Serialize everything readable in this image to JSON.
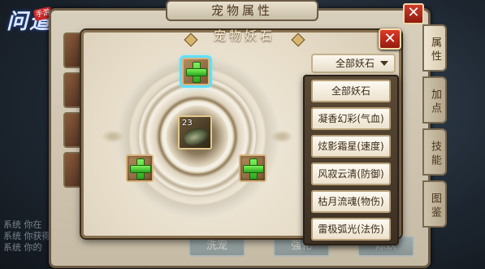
{
  "game": {
    "logo_text": "问道",
    "logo_badge": "手游"
  },
  "chat": {
    "lines": [
      "系统 你在",
      "系统 你获得",
      "系统 你的"
    ]
  },
  "outer_window": {
    "title": "宠物属性",
    "close_label": "✕",
    "side_tabs": [
      "属性",
      "加点",
      "技能",
      "图鉴"
    ],
    "bottom_buttons": [
      "洗宠",
      "强化",
      "炼妖"
    ]
  },
  "dialog": {
    "title": "宠物妖石",
    "close_label": "✕",
    "pet_level": "23",
    "dropdown": {
      "selected": "全部妖石",
      "options": [
        "全部妖石",
        "凝香幻彩(气血)",
        "炫影霜星(速度)",
        "风寂云清(防御)",
        "枯月流魂(物伤)",
        "雷极弧光(法伤)"
      ]
    }
  },
  "colors": {
    "close_red": "#d03a2a",
    "plus_green": "#4fd23a",
    "selected_glow": "#5ee0ff",
    "frame_brown": "#8a7250"
  }
}
